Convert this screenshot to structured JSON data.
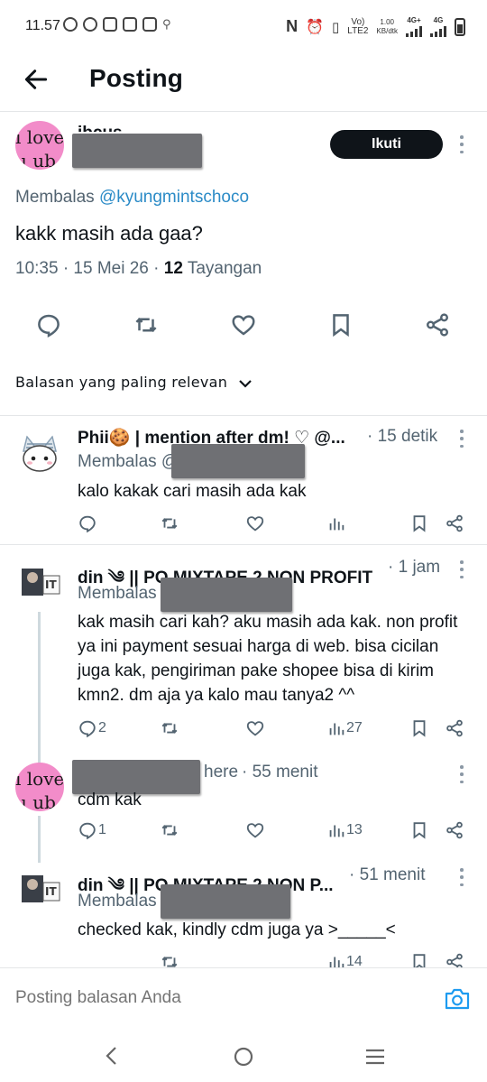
{
  "status": {
    "time": "11.57",
    "net_small": "LTE2",
    "speed": "1.00",
    "speed_unit": "KB/dtk",
    "net1": "4G+",
    "net2": "4G"
  },
  "header": {
    "title": "Posting"
  },
  "main_post": {
    "avatar_line1": "i love",
    "avatar_line2": "u  ub",
    "name_partial": "ibcus",
    "follow_label": "Ikuti",
    "reply_prefix": "Membalas",
    "reply_handle": "@kyungmintschoco",
    "text": "kakk masih ada gaa?",
    "time": "10:35 · 15 Mei 26 · ",
    "views_count": "12",
    "views_label": " Tayangan"
  },
  "sort_label": "Balasan yang paling relevan",
  "replies": [
    {
      "name": "Phii🍪 | mention after dm! ♡ @...",
      "time": "· 15 detik",
      "reply_prefix": "Membalas @",
      "text": "kalo kakak cari masih ada kak",
      "reply_count": "",
      "views": ""
    },
    {
      "name": "din ༄ || PO MIXTAPE 2 NON PROFIT",
      "time": "· 1 jam",
      "reply_prefix": "Membalas",
      "text": "kak masih cari kah? aku masih ada kak. non profit ya ini payment sesuai harga di web. bisa cicilan juga kak, pengiriman pake shopee bisa di kirim kmn2. dm aja ya kalo mau tanya2 ^^",
      "reply_count": "2",
      "views": "27"
    },
    {
      "name_tail": "here",
      "time": "· 55 menit",
      "text": "cdm kak",
      "avatar_line1": "i love",
      "avatar_line2": "u  ub",
      "reply_count": "1",
      "views": "13"
    },
    {
      "name": "din ༄ || PO MIXTAPE 2 NON P...",
      "time": "· 51 menit",
      "reply_prefix": "Membalas",
      "text": "checked kak, kindly cdm juga ya >_____<",
      "views": "14"
    }
  ],
  "compose": {
    "placeholder": "Posting balasan Anda"
  },
  "colors": {
    "accent": "#1d9bf0",
    "text": "#0f1419",
    "muted": "#536471",
    "follow_bg": "#0f1419",
    "avatar_pink": "#f28cc9",
    "redaction": "#6f7074"
  }
}
